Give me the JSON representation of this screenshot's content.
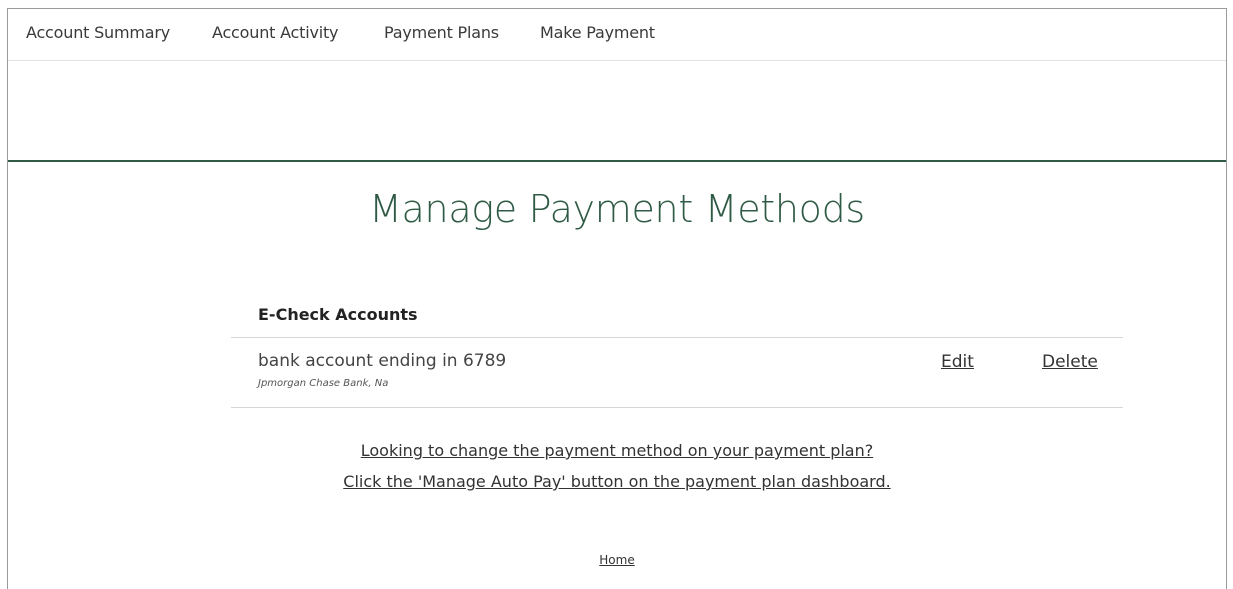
{
  "nav": {
    "items": [
      {
        "label": "Account Summary"
      },
      {
        "label": "Account Activity"
      },
      {
        "label": "Payment Plans"
      },
      {
        "label": "Make Payment"
      }
    ]
  },
  "page": {
    "title": "Manage Payment Methods"
  },
  "echeck": {
    "heading": "E-Check Accounts",
    "accounts": [
      {
        "name": "bank account ending in 6789",
        "bank": "Jpmorgan Chase Bank, Na",
        "edit_label": "Edit",
        "delete_label": "Delete"
      }
    ]
  },
  "hints": {
    "line1": "Looking to change the payment method on your payment plan?",
    "line2": "Click the 'Manage Auto Pay' button on the payment plan dashboard."
  },
  "footer": {
    "home_label": "Home"
  },
  "colors": {
    "accent": "#2f5a45",
    "text": "#333333",
    "border": "#d7d7d7"
  }
}
